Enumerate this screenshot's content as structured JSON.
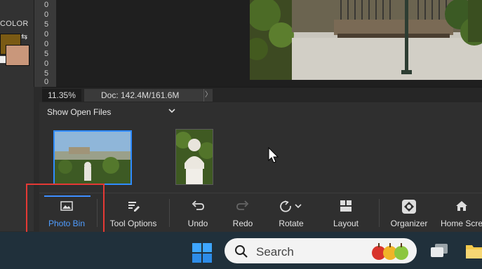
{
  "color_panel": {
    "label": "COLOR",
    "foreground": "#7a5a14",
    "background": "#c9977b"
  },
  "ruler": {
    "digits": [
      "0",
      "0",
      "5",
      "0",
      "0",
      "5",
      "0",
      "5",
      "0"
    ]
  },
  "status": {
    "zoom": "11.35%",
    "doc_info": "Doc: 142.4M/161.6M",
    "arrow": "〉"
  },
  "bin": {
    "dropdown_label": "Show Open Files",
    "thumbnails": [
      "city-panorama-thumbnail",
      "bust-statue-thumbnail"
    ]
  },
  "toolbar": {
    "photo_bin": "Photo Bin",
    "tool_options": "Tool Options",
    "undo": "Undo",
    "redo": "Redo",
    "rotate": "Rotate",
    "layout": "Layout",
    "organizer": "Organizer",
    "home_screen": "Home Scre"
  },
  "taskbar": {
    "search_placeholder": "Search"
  },
  "colors": {
    "accent": "#3d8eff",
    "highlight": "#e53935",
    "taskbar": "#20303b"
  }
}
